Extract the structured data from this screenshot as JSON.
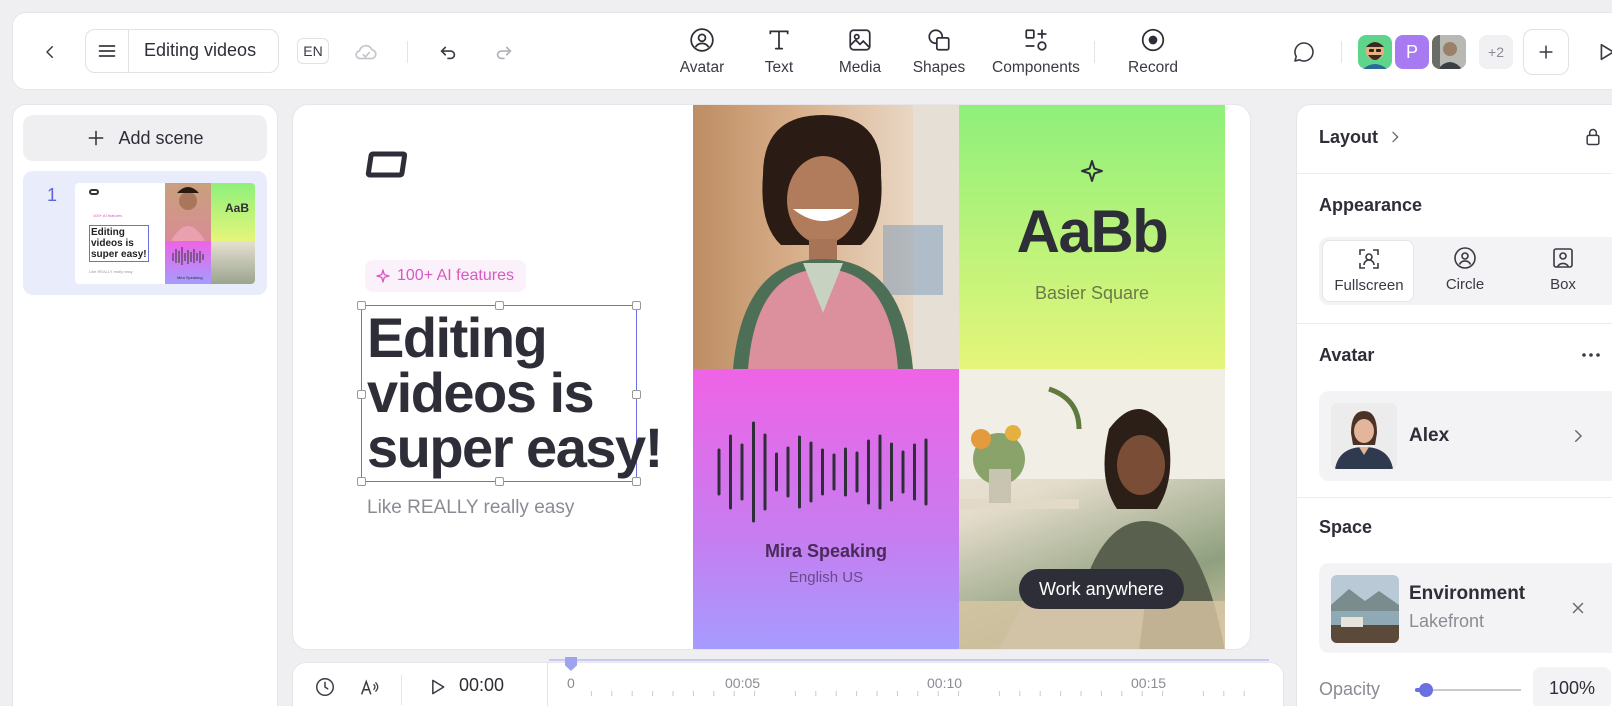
{
  "topbar": {
    "project_title": "Editing videos",
    "language": "EN",
    "tools": [
      {
        "label": "Avatar",
        "icon": "avatar-icon"
      },
      {
        "label": "Text",
        "icon": "text-icon"
      },
      {
        "label": "Media",
        "icon": "media-icon"
      },
      {
        "label": "Shapes",
        "icon": "shapes-icon"
      },
      {
        "label": "Components",
        "icon": "components-icon"
      },
      {
        "label": "Record",
        "icon": "record-icon"
      }
    ],
    "collaborator_initial": "P",
    "more_collaborators": "+2"
  },
  "scenes": {
    "add_label": "Add scene",
    "items": [
      {
        "number": "1",
        "thumb_title": "Editing videos is super easy!",
        "thumb_badge": "100+ AI features",
        "thumb_sub": "Like REALLY really easy",
        "thumb_font": "AaB",
        "thumb_speaker": "Mira Speaking"
      }
    ]
  },
  "canvas": {
    "badge": "100+ AI features",
    "headline_line1": "Editing",
    "headline_line2": "videos is",
    "headline_line3": "super easy!",
    "subtitle": "Like REALLY really easy",
    "font_sample": "AaBb",
    "font_name": "Basier Square",
    "speaker_name": "Mira Speaking",
    "speaker_lang": "English US",
    "caption_pill": "Work anywhere",
    "colors": {
      "accent": "#6b6fe0",
      "badge_text": "#d65ac0",
      "green_top": "#8ef07a",
      "green_bottom": "#e6f57a",
      "pink_top": "#ef63e6",
      "purple_bottom": "#a59cff"
    }
  },
  "timeline": {
    "time": "00:00",
    "marks": [
      "0",
      "00:05",
      "00:10",
      "00:15"
    ]
  },
  "props": {
    "layout_title": "Layout",
    "appearance_title": "Appearance",
    "appearance_options": [
      {
        "label": "Fullscreen",
        "icon": "fullscreen-icon",
        "selected": true
      },
      {
        "label": "Circle",
        "icon": "circle-avatar-icon",
        "selected": false
      },
      {
        "label": "Box",
        "icon": "box-avatar-icon",
        "selected": false
      }
    ],
    "avatar_title": "Avatar",
    "avatar_name": "Alex",
    "space_title": "Space",
    "environment_label": "Environment",
    "environment_value": "Lakefront",
    "opacity_label": "Opacity",
    "opacity_value": "100%"
  }
}
